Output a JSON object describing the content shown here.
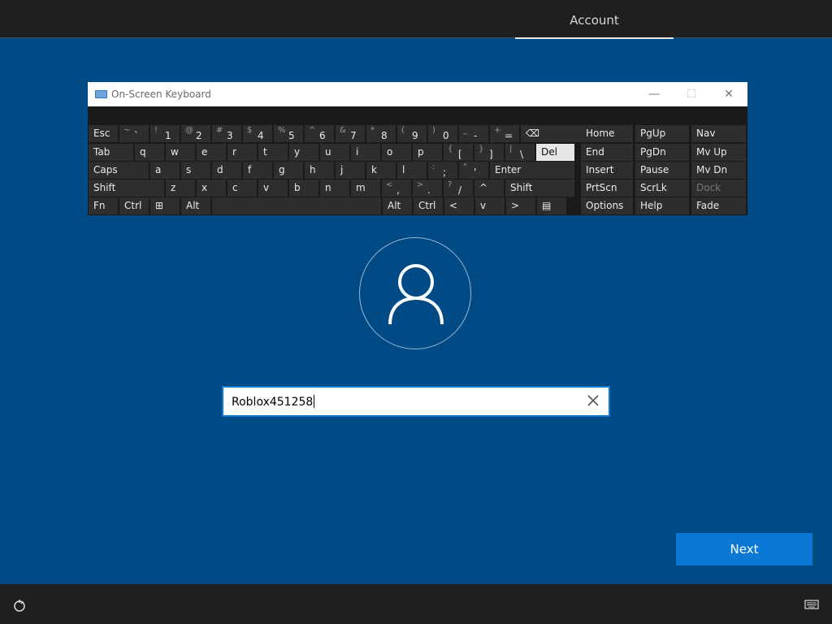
{
  "header": {
    "active_tab": "Account"
  },
  "osk": {
    "title": "On-Screen Keyboard",
    "minimize": "—",
    "maximize": "☐",
    "close": "✕",
    "rows": [
      [
        {
          "l": "Esc"
        },
        {
          "s": "~",
          "p": "`"
        },
        {
          "s": "!",
          "p": "1"
        },
        {
          "s": "@",
          "p": "2"
        },
        {
          "s": "#",
          "p": "3"
        },
        {
          "s": "$",
          "p": "4"
        },
        {
          "s": "%",
          "p": "5"
        },
        {
          "s": "^",
          "p": "6"
        },
        {
          "s": "&",
          "p": "7"
        },
        {
          "s": "*",
          "p": "8"
        },
        {
          "s": "(",
          "p": "9"
        },
        {
          "s": ")",
          "p": "0"
        },
        {
          "s": "_",
          "p": "-"
        },
        {
          "s": "+",
          "p": "="
        },
        {
          "l": "⌫"
        }
      ],
      [
        {
          "l": "Tab"
        },
        {
          "l": "q"
        },
        {
          "l": "w"
        },
        {
          "l": "e"
        },
        {
          "l": "r"
        },
        {
          "l": "t"
        },
        {
          "l": "y"
        },
        {
          "l": "u"
        },
        {
          "l": "i"
        },
        {
          "l": "o"
        },
        {
          "l": "p"
        },
        {
          "s": "{",
          "p": "["
        },
        {
          "s": "}",
          "p": "]"
        },
        {
          "s": "|",
          "p": "\\"
        },
        {
          "l": "Del"
        }
      ],
      [
        {
          "l": "Caps"
        },
        {
          "l": "a"
        },
        {
          "l": "s"
        },
        {
          "l": "d"
        },
        {
          "l": "f"
        },
        {
          "l": "g"
        },
        {
          "l": "h"
        },
        {
          "l": "j"
        },
        {
          "l": "k"
        },
        {
          "l": "l"
        },
        {
          "s": ":",
          "p": ";"
        },
        {
          "s": "\"",
          "p": "'"
        },
        {
          "l": "Enter"
        }
      ],
      [
        {
          "l": "Shift"
        },
        {
          "l": "z"
        },
        {
          "l": "x"
        },
        {
          "l": "c"
        },
        {
          "l": "v"
        },
        {
          "l": "b"
        },
        {
          "l": "n"
        },
        {
          "l": "m"
        },
        {
          "s": "<",
          "p": ","
        },
        {
          "s": ">",
          "p": "."
        },
        {
          "s": "?",
          "p": "/"
        },
        {
          "l": "^"
        },
        {
          "l": "Shift"
        }
      ],
      [
        {
          "l": "Fn"
        },
        {
          "l": "Ctrl"
        },
        {
          "l": "⊞"
        },
        {
          "l": "Alt"
        },
        {
          "l": ""
        },
        {
          "l": "Alt"
        },
        {
          "l": "Ctrl"
        },
        {
          "l": "<"
        },
        {
          "l": "v"
        },
        {
          "l": ">"
        },
        {
          "l": "▤"
        }
      ]
    ],
    "nav_rows": [
      [
        "Home",
        "PgUp",
        "Nav"
      ],
      [
        "End",
        "PgDn",
        "Mv Up"
      ],
      [
        "Insert",
        "Pause",
        "Mv Dn"
      ],
      [
        "PrtScn",
        "ScrLk",
        "Dock"
      ],
      [
        "Options",
        "Help",
        "Fade"
      ]
    ]
  },
  "username": {
    "value": "Roblox451258"
  },
  "next_label": "Next",
  "colors": {
    "background": "#004a86",
    "accent": "#0a78d4",
    "bars": "#1f1f1f"
  }
}
